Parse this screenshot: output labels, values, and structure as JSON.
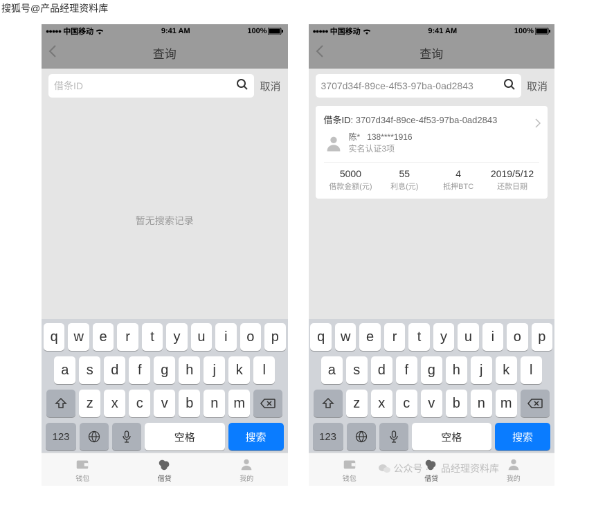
{
  "watermark_top": "搜狐号@产品经理资料库",
  "watermark_bottom_text": "公众号 · 　品经理资料库",
  "status": {
    "carrier": "中国移动",
    "time": "9:41 AM",
    "battery": "100%"
  },
  "nav": {
    "title": "查询"
  },
  "search": {
    "placeholder": "借条ID",
    "cancel": "取消"
  },
  "left_screen": {
    "input_value": "",
    "empty_text": "暂无搜索记录"
  },
  "right_screen": {
    "input_value": "3707d34f-89ce-4f53-97ba-0ad2843",
    "result": {
      "id_label": "借条ID:",
      "id_value": "3707d34f-89ce-4f53-97ba-0ad2843",
      "user_name": "陈*",
      "user_phone": "138****1916",
      "user_verify": "实名认证3项",
      "stats": [
        {
          "value": "5000",
          "label": "借款金额(元)"
        },
        {
          "value": "55",
          "label": "利息(元)"
        },
        {
          "value": "4",
          "label": "抵押BTC"
        },
        {
          "value": "2019/5/12",
          "label": "还款日期"
        }
      ]
    }
  },
  "keyboard": {
    "row1": [
      "q",
      "w",
      "e",
      "r",
      "t",
      "y",
      "u",
      "i",
      "o",
      "p"
    ],
    "row2": [
      "a",
      "s",
      "d",
      "f",
      "g",
      "h",
      "j",
      "k",
      "l"
    ],
    "row3": [
      "z",
      "x",
      "c",
      "v",
      "b",
      "n",
      "m"
    ],
    "num_key": "123",
    "space": "空格",
    "search": "搜索"
  },
  "tabs": {
    "wallet": "钱包",
    "loan": "借贷",
    "mine": "我的"
  }
}
